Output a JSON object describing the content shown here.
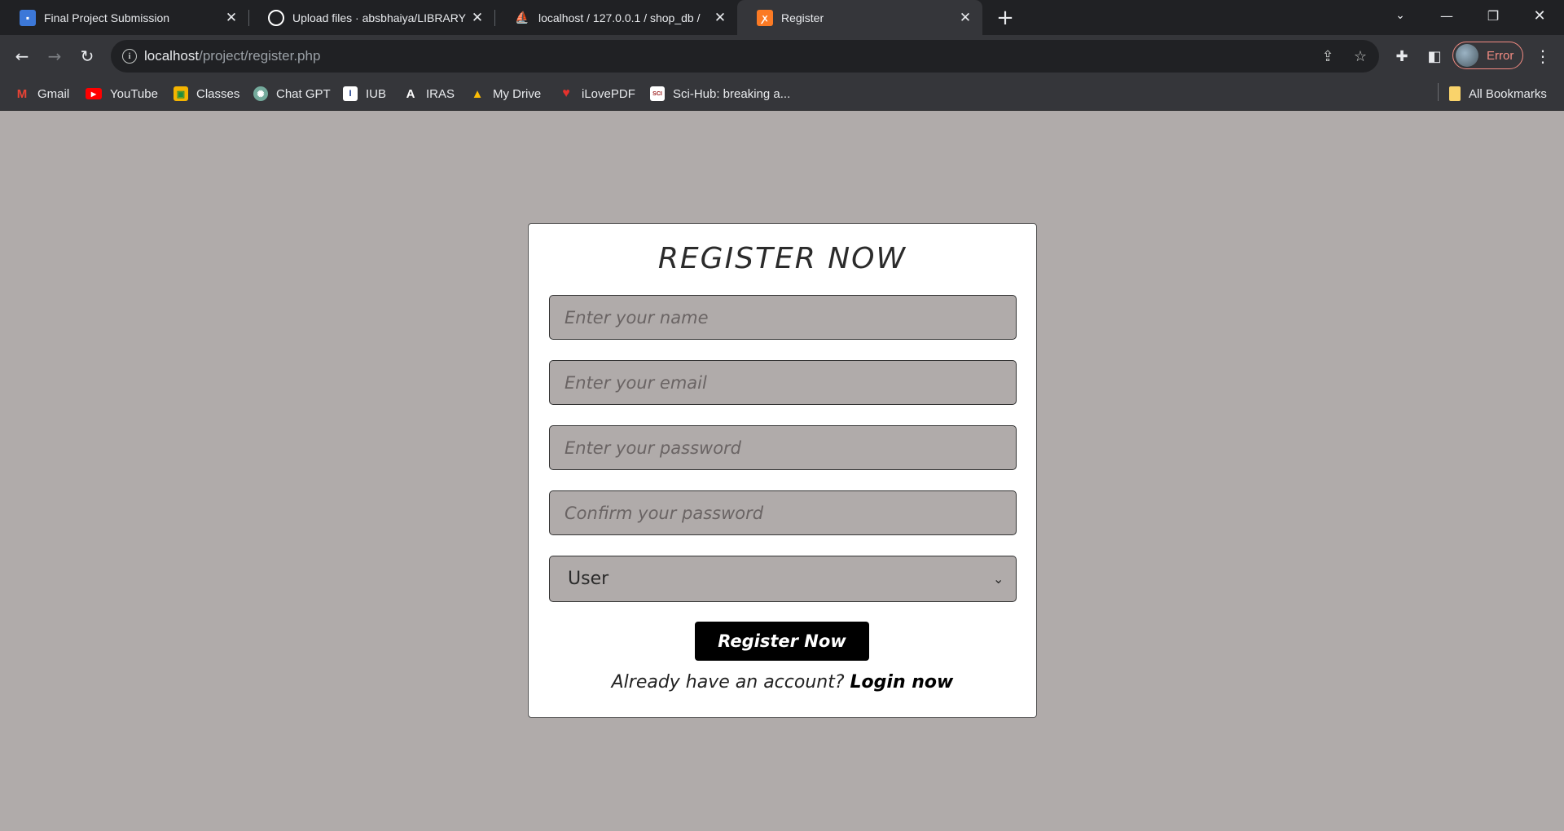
{
  "browser": {
    "tabs": [
      {
        "title": "Final Project Submission",
        "icon": "classroom-icon",
        "color": "#3c78d8"
      },
      {
        "title": "Upload files · absbhaiya/LIBRARY",
        "icon": "github-icon",
        "color": "#ffffff"
      },
      {
        "title": "localhost / 127.0.0.1 / shop_db /",
        "icon": "phpmyadmin-icon",
        "color": "#f0a030"
      },
      {
        "title": "Register",
        "icon": "xampp-icon",
        "color": "#fb7a24"
      }
    ],
    "url_host": "localhost",
    "url_path": "/project/register.php",
    "profile_status": "Error",
    "bookmarks": [
      {
        "label": "Gmail",
        "icon": "gmail-icon"
      },
      {
        "label": "YouTube",
        "icon": "youtube-icon"
      },
      {
        "label": "Classes",
        "icon": "classes-icon"
      },
      {
        "label": "Chat GPT",
        "icon": "chatgpt-icon"
      },
      {
        "label": "IUB",
        "icon": "iub-icon"
      },
      {
        "label": "IRAS",
        "icon": "iras-icon"
      },
      {
        "label": "My Drive",
        "icon": "drive-icon"
      },
      {
        "label": "iLovePDF",
        "icon": "ilovepdf-icon"
      },
      {
        "label": "Sci-Hub: breaking a...",
        "icon": "scihub-icon"
      }
    ],
    "all_bookmarks": "All Bookmarks"
  },
  "form": {
    "title": "REGISTER NOW",
    "name_placeholder": "Enter your name",
    "email_placeholder": "Enter your email",
    "password_placeholder": "Enter your password",
    "confirm_placeholder": "Confirm your password",
    "user_type": "User",
    "submit_label": "Register Now",
    "already_text": "Already have an account?",
    "login_link": "Login now"
  }
}
